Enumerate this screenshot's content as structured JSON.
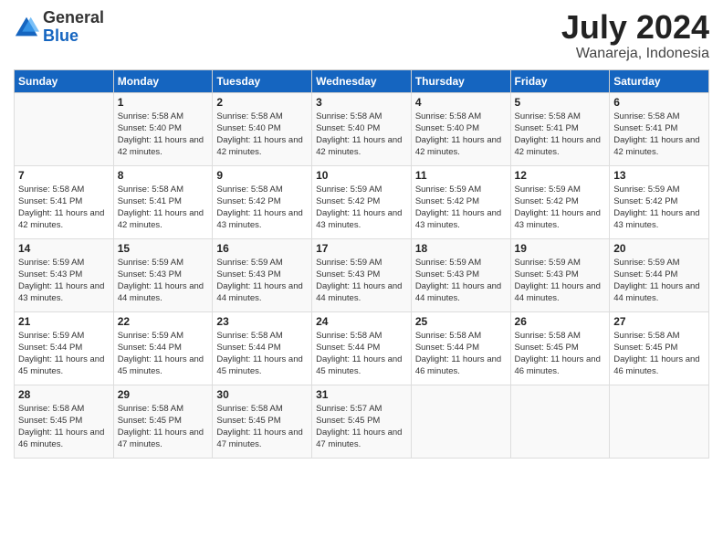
{
  "logo": {
    "general": "General",
    "blue": "Blue"
  },
  "title": {
    "month": "July 2024",
    "location": "Wanareja, Indonesia"
  },
  "headers": [
    "Sunday",
    "Monday",
    "Tuesday",
    "Wednesday",
    "Thursday",
    "Friday",
    "Saturday"
  ],
  "weeks": [
    [
      {
        "day": "",
        "sunrise": "",
        "sunset": "",
        "daylight": ""
      },
      {
        "day": "1",
        "sunrise": "Sunrise: 5:58 AM",
        "sunset": "Sunset: 5:40 PM",
        "daylight": "Daylight: 11 hours and 42 minutes."
      },
      {
        "day": "2",
        "sunrise": "Sunrise: 5:58 AM",
        "sunset": "Sunset: 5:40 PM",
        "daylight": "Daylight: 11 hours and 42 minutes."
      },
      {
        "day": "3",
        "sunrise": "Sunrise: 5:58 AM",
        "sunset": "Sunset: 5:40 PM",
        "daylight": "Daylight: 11 hours and 42 minutes."
      },
      {
        "day": "4",
        "sunrise": "Sunrise: 5:58 AM",
        "sunset": "Sunset: 5:40 PM",
        "daylight": "Daylight: 11 hours and 42 minutes."
      },
      {
        "day": "5",
        "sunrise": "Sunrise: 5:58 AM",
        "sunset": "Sunset: 5:41 PM",
        "daylight": "Daylight: 11 hours and 42 minutes."
      },
      {
        "day": "6",
        "sunrise": "Sunrise: 5:58 AM",
        "sunset": "Sunset: 5:41 PM",
        "daylight": "Daylight: 11 hours and 42 minutes."
      }
    ],
    [
      {
        "day": "7",
        "sunrise": "Sunrise: 5:58 AM",
        "sunset": "Sunset: 5:41 PM",
        "daylight": "Daylight: 11 hours and 42 minutes."
      },
      {
        "day": "8",
        "sunrise": "Sunrise: 5:58 AM",
        "sunset": "Sunset: 5:41 PM",
        "daylight": "Daylight: 11 hours and 42 minutes."
      },
      {
        "day": "9",
        "sunrise": "Sunrise: 5:58 AM",
        "sunset": "Sunset: 5:42 PM",
        "daylight": "Daylight: 11 hours and 43 minutes."
      },
      {
        "day": "10",
        "sunrise": "Sunrise: 5:59 AM",
        "sunset": "Sunset: 5:42 PM",
        "daylight": "Daylight: 11 hours and 43 minutes."
      },
      {
        "day": "11",
        "sunrise": "Sunrise: 5:59 AM",
        "sunset": "Sunset: 5:42 PM",
        "daylight": "Daylight: 11 hours and 43 minutes."
      },
      {
        "day": "12",
        "sunrise": "Sunrise: 5:59 AM",
        "sunset": "Sunset: 5:42 PM",
        "daylight": "Daylight: 11 hours and 43 minutes."
      },
      {
        "day": "13",
        "sunrise": "Sunrise: 5:59 AM",
        "sunset": "Sunset: 5:42 PM",
        "daylight": "Daylight: 11 hours and 43 minutes."
      }
    ],
    [
      {
        "day": "14",
        "sunrise": "Sunrise: 5:59 AM",
        "sunset": "Sunset: 5:43 PM",
        "daylight": "Daylight: 11 hours and 43 minutes."
      },
      {
        "day": "15",
        "sunrise": "Sunrise: 5:59 AM",
        "sunset": "Sunset: 5:43 PM",
        "daylight": "Daylight: 11 hours and 44 minutes."
      },
      {
        "day": "16",
        "sunrise": "Sunrise: 5:59 AM",
        "sunset": "Sunset: 5:43 PM",
        "daylight": "Daylight: 11 hours and 44 minutes."
      },
      {
        "day": "17",
        "sunrise": "Sunrise: 5:59 AM",
        "sunset": "Sunset: 5:43 PM",
        "daylight": "Daylight: 11 hours and 44 minutes."
      },
      {
        "day": "18",
        "sunrise": "Sunrise: 5:59 AM",
        "sunset": "Sunset: 5:43 PM",
        "daylight": "Daylight: 11 hours and 44 minutes."
      },
      {
        "day": "19",
        "sunrise": "Sunrise: 5:59 AM",
        "sunset": "Sunset: 5:43 PM",
        "daylight": "Daylight: 11 hours and 44 minutes."
      },
      {
        "day": "20",
        "sunrise": "Sunrise: 5:59 AM",
        "sunset": "Sunset: 5:44 PM",
        "daylight": "Daylight: 11 hours and 44 minutes."
      }
    ],
    [
      {
        "day": "21",
        "sunrise": "Sunrise: 5:59 AM",
        "sunset": "Sunset: 5:44 PM",
        "daylight": "Daylight: 11 hours and 45 minutes."
      },
      {
        "day": "22",
        "sunrise": "Sunrise: 5:59 AM",
        "sunset": "Sunset: 5:44 PM",
        "daylight": "Daylight: 11 hours and 45 minutes."
      },
      {
        "day": "23",
        "sunrise": "Sunrise: 5:58 AM",
        "sunset": "Sunset: 5:44 PM",
        "daylight": "Daylight: 11 hours and 45 minutes."
      },
      {
        "day": "24",
        "sunrise": "Sunrise: 5:58 AM",
        "sunset": "Sunset: 5:44 PM",
        "daylight": "Daylight: 11 hours and 45 minutes."
      },
      {
        "day": "25",
        "sunrise": "Sunrise: 5:58 AM",
        "sunset": "Sunset: 5:44 PM",
        "daylight": "Daylight: 11 hours and 46 minutes."
      },
      {
        "day": "26",
        "sunrise": "Sunrise: 5:58 AM",
        "sunset": "Sunset: 5:45 PM",
        "daylight": "Daylight: 11 hours and 46 minutes."
      },
      {
        "day": "27",
        "sunrise": "Sunrise: 5:58 AM",
        "sunset": "Sunset: 5:45 PM",
        "daylight": "Daylight: 11 hours and 46 minutes."
      }
    ],
    [
      {
        "day": "28",
        "sunrise": "Sunrise: 5:58 AM",
        "sunset": "Sunset: 5:45 PM",
        "daylight": "Daylight: 11 hours and 46 minutes."
      },
      {
        "day": "29",
        "sunrise": "Sunrise: 5:58 AM",
        "sunset": "Sunset: 5:45 PM",
        "daylight": "Daylight: 11 hours and 47 minutes."
      },
      {
        "day": "30",
        "sunrise": "Sunrise: 5:58 AM",
        "sunset": "Sunset: 5:45 PM",
        "daylight": "Daylight: 11 hours and 47 minutes."
      },
      {
        "day": "31",
        "sunrise": "Sunrise: 5:57 AM",
        "sunset": "Sunset: 5:45 PM",
        "daylight": "Daylight: 11 hours and 47 minutes."
      },
      {
        "day": "",
        "sunrise": "",
        "sunset": "",
        "daylight": ""
      },
      {
        "day": "",
        "sunrise": "",
        "sunset": "",
        "daylight": ""
      },
      {
        "day": "",
        "sunrise": "",
        "sunset": "",
        "daylight": ""
      }
    ]
  ]
}
